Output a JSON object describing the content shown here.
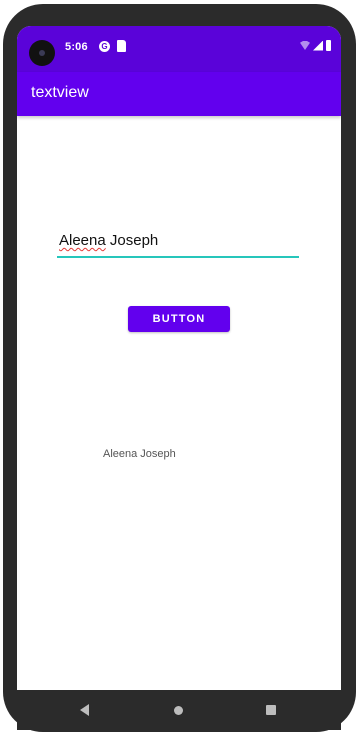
{
  "status_bar": {
    "time": "5:06",
    "left_icons": [
      "google-icon",
      "sd-card-icon"
    ],
    "right_icons": [
      "wifi-icon",
      "signal-icon",
      "battery-icon"
    ],
    "background_color": "#5a03d9"
  },
  "app_bar": {
    "title": "textview",
    "background_color": "#6200ee"
  },
  "edit_text": {
    "value_first": "Aleena",
    "value_rest": " Joseph",
    "underline_color": "#26c6bb"
  },
  "button": {
    "label": "BUTTON"
  },
  "output": {
    "text": "Aleena Joseph"
  },
  "nav_bar": {
    "icons": [
      "back-icon",
      "home-icon",
      "recents-icon"
    ]
  }
}
